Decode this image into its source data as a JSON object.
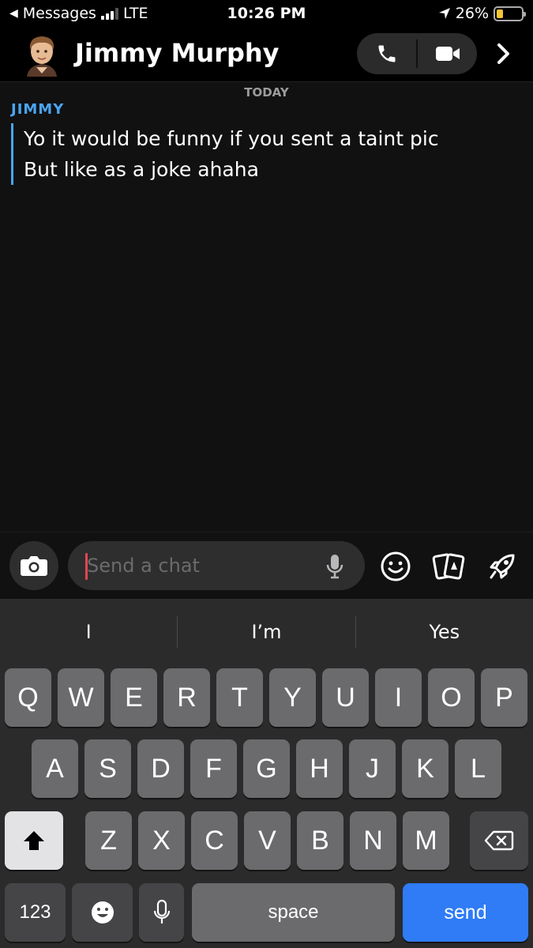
{
  "status_bar": {
    "back_app": "Messages",
    "network": "LTE",
    "time": "10:26 PM",
    "battery_percent": "26%",
    "battery_level": 0.26,
    "signal_bars": 3
  },
  "header": {
    "contact_name": "Jimmy Murphy",
    "icons": [
      "avatar",
      "phone-icon",
      "video-camera-icon",
      "chevron-right-icon"
    ]
  },
  "chat": {
    "date_divider": "TODAY",
    "messages": [
      {
        "sender": "JIMMY",
        "lines": [
          "Yo it would be funny if you sent a taint pic",
          "But like as a joke ahaha"
        ]
      }
    ]
  },
  "input": {
    "placeholder": "Send a chat",
    "value": "",
    "icons": [
      "camera-icon",
      "microphone-icon",
      "emoji-icon",
      "cards-icon",
      "rocket-icon"
    ]
  },
  "keyboard": {
    "suggestions": [
      "I",
      "I’m",
      "Yes"
    ],
    "row1": [
      "Q",
      "W",
      "E",
      "R",
      "T",
      "Y",
      "U",
      "I",
      "O",
      "P"
    ],
    "row2": [
      "A",
      "S",
      "D",
      "F",
      "G",
      "H",
      "J",
      "K",
      "L"
    ],
    "row3": [
      "Z",
      "X",
      "C",
      "V",
      "B",
      "N",
      "M"
    ],
    "numbers_label": "123",
    "space_label": "space",
    "send_label": "send"
  },
  "colors": {
    "accent_blue": "#4aa5f0",
    "send_blue": "#2f7cf6",
    "caret_red": "#e34652",
    "battery_yellow": "#f4c631"
  }
}
